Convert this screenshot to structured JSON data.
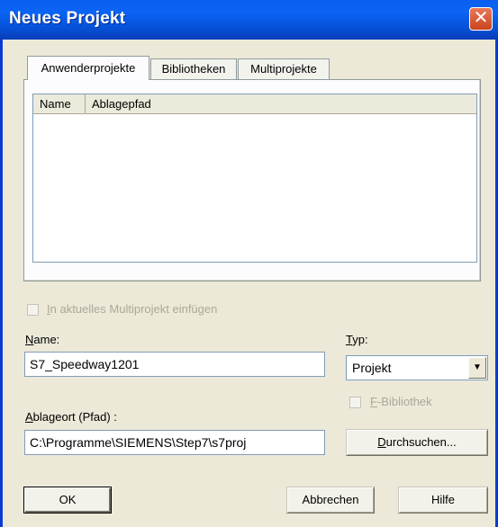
{
  "window": {
    "title": "Neues Projekt",
    "close_glyph": "✕",
    "colors": {
      "titlebar": "#0a5ef0",
      "close": "#c9431c",
      "dialog_bg": "#ece9d8"
    }
  },
  "tabs": [
    {
      "label": "Anwenderprojekte",
      "active": true
    },
    {
      "label": "Bibliotheken",
      "active": false
    },
    {
      "label": "Multiprojekte",
      "active": false
    }
  ],
  "list": {
    "columns": [
      "Name",
      "Ablagepfad"
    ],
    "rows": []
  },
  "multiproject_checkbox": {
    "label": "In aktuelles Multiprojekt einfügen",
    "checked": false,
    "enabled": false
  },
  "name_field": {
    "label_underline": "N",
    "label_rest": "ame:",
    "value": "S7_Speedway1201"
  },
  "type_field": {
    "label_underline": "T",
    "label_rest": "yp:",
    "value": "Projekt",
    "arrow": "▼"
  },
  "fbib_checkbox": {
    "label_underline": "F",
    "label_rest": "-Bibliothek",
    "checked": false,
    "enabled": false
  },
  "path_field": {
    "label_underline": "A",
    "label_rest": "blageort (Pfad) :",
    "value": "C:\\Programme\\SIEMENS\\Step7\\s7proj"
  },
  "buttons": {
    "browse": {
      "label_underline": "D",
      "label_rest": "urchsuchen..."
    },
    "ok": "OK",
    "cancel": "Abbrechen",
    "help": "Hilfe"
  }
}
